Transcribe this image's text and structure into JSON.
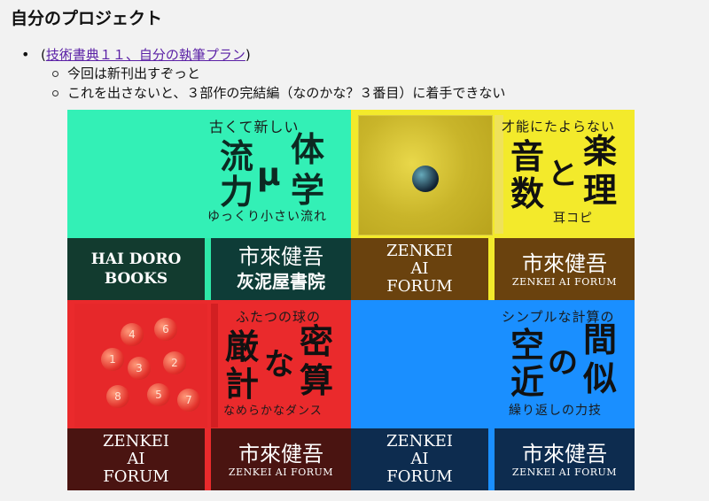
{
  "page": {
    "title": "自分のプロジェクト"
  },
  "list": {
    "paren_open": "(",
    "link_text": "技術書典１１、自分の執筆プラン",
    "paren_close": ")",
    "sub_items": [
      "今回は新刊出すぞっと",
      "これを出さないと、３部作の完結編（なのかな？３番目）に着手できない"
    ]
  },
  "covers": [
    {
      "subtitle": "古くて新しい",
      "chars": [
        "流",
        "体",
        "力",
        "学"
      ],
      "mu": "μ",
      "tagline": "ゆっくり小さい流れ",
      "left_brand": [
        "HAI DORO",
        "BOOKS"
      ],
      "right_brand_name": "市來健吾",
      "right_brand_sub": "灰泥屋書院",
      "colors": {
        "top": "#33f0b6",
        "left_band": "#123b2f",
        "right_band": "#0e3c37",
        "accent": "#2ee8a8"
      }
    },
    {
      "subtitle": "才能にたよらない",
      "chars": [
        "音",
        "楽",
        "数",
        "理"
      ],
      "center": "と",
      "tagline": "耳コピ",
      "left_brand": [
        "ZENKEI",
        "AI",
        "FORUM"
      ],
      "right_brand_name": "市來健吾",
      "right_brand_sub": "ZENKEI AI FORUM",
      "colors": {
        "top": "#f3ea2b",
        "left_band": "#6a420e",
        "right_band": "#6a420e",
        "accent": "#f3ea2b"
      }
    },
    {
      "subtitle": "ふたつの球の",
      "chars": [
        "厳",
        "密",
        "計",
        "算"
      ],
      "center": "な",
      "tagline": "なめらかなダンス",
      "ball_numbers": [
        "4",
        "6",
        "1",
        "2",
        "3",
        "5",
        "8",
        "7"
      ],
      "left_brand": [
        "ZENKEI",
        "AI",
        "FORUM"
      ],
      "right_brand_name": "市來健吾",
      "right_brand_sub": "ZENKEI AI FORUM",
      "colors": {
        "top": "#ea2a2c",
        "left_band": "#4a1411",
        "right_band": "#4a1411",
        "accent": "#ea2a2c"
      }
    },
    {
      "subtitle": "シンプルな計算の",
      "chars": [
        "空",
        "間",
        "近",
        "似"
      ],
      "center": "の",
      "tagline": "繰り返しの力技",
      "left_brand": [
        "ZENKEI",
        "AI",
        "FORUM"
      ],
      "right_brand_name": "市來健吾",
      "right_brand_sub": "ZENKEI AI FORUM",
      "colors": {
        "top": "#1a8fff",
        "left_band": "#0d2c4f",
        "right_band": "#0d2c4f",
        "accent": "#1a8fff"
      }
    }
  ]
}
